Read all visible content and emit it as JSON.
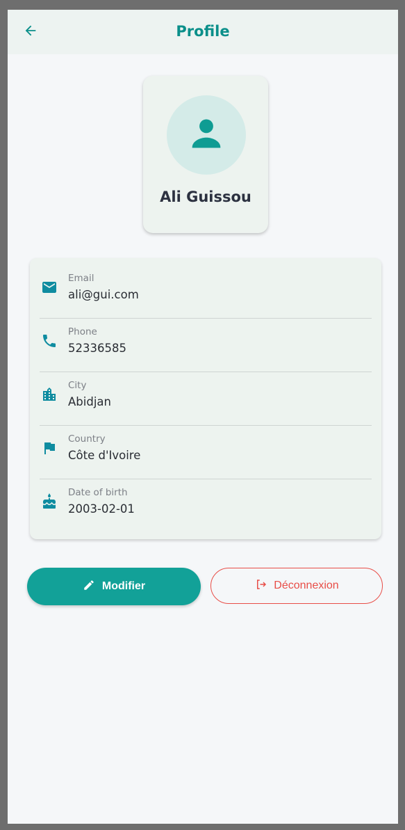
{
  "appbar": {
    "title": "Profile",
    "back_icon": "arrow-back-icon"
  },
  "profile": {
    "avatar_icon": "person-icon",
    "name": "Ali Guissou"
  },
  "info": [
    {
      "icon": "email-icon",
      "label": "Email",
      "value": "ali@gui.com"
    },
    {
      "icon": "phone-icon",
      "label": "Phone",
      "value": "52336585"
    },
    {
      "icon": "city-icon",
      "label": "City",
      "value": "Abidjan"
    },
    {
      "icon": "flag-icon",
      "label": "Country",
      "value": "Côte d'Ivoire"
    },
    {
      "icon": "cake-icon",
      "label": "Date of birth",
      "value": "2003-02-01"
    }
  ],
  "actions": {
    "modify_label": "Modifier",
    "modify_icon": "edit-icon",
    "logout_label": "Déconnexion",
    "logout_icon": "logout-icon"
  },
  "colors": {
    "primary": "#12a198",
    "title": "#0b8f8a",
    "danger": "#e84d47",
    "background": "#f5f7f9",
    "card": "#edf3ef",
    "avatar_bg": "#d4ebe8"
  }
}
